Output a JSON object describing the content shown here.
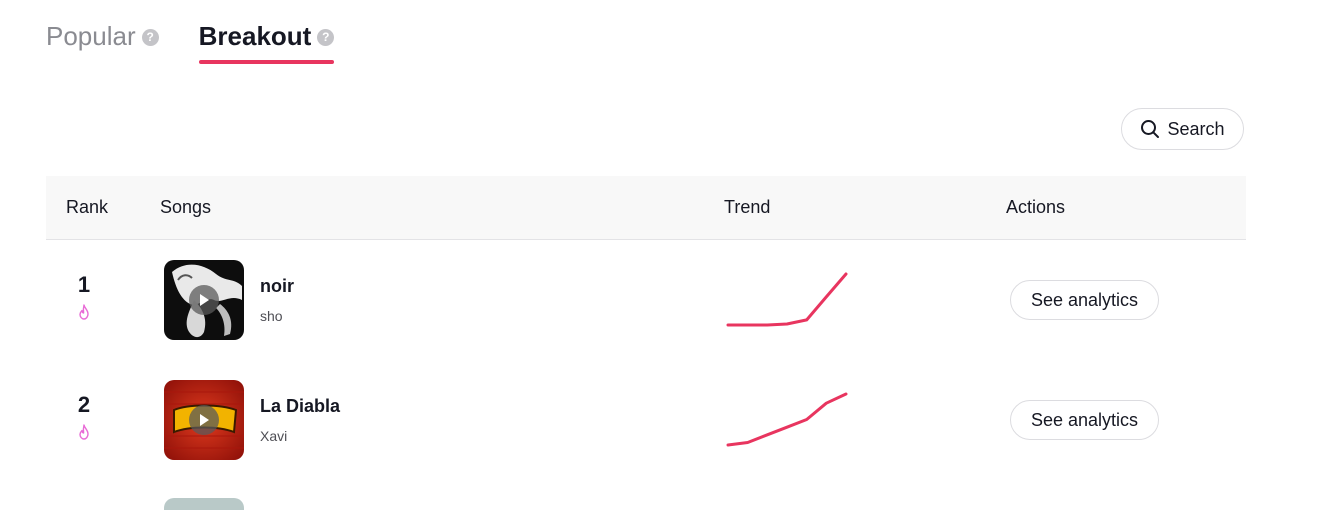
{
  "tabs": [
    {
      "label": "Popular",
      "active": false,
      "help_icon": "question-icon"
    },
    {
      "label": "Breakout",
      "active": true,
      "help_icon": "question-icon"
    }
  ],
  "colors": {
    "accent": "#e8355f",
    "fire": "#e86bd6"
  },
  "search": {
    "label": "Search",
    "icon": "search-icon"
  },
  "table": {
    "headers": {
      "rank": "Rank",
      "songs": "Songs",
      "trend": "Trend",
      "actions": "Actions"
    },
    "rows": [
      {
        "rank": "1",
        "rank_icon": "fire-icon",
        "title": "noir",
        "artist": "sho",
        "trend": [
          0.0,
          0.0,
          0.0,
          0.02,
          0.1,
          0.55,
          1.0
        ],
        "action": "See analytics"
      },
      {
        "rank": "2",
        "rank_icon": "fire-icon",
        "title": "La Diabla",
        "artist": "Xavi",
        "trend": [
          0.0,
          0.05,
          0.2,
          0.35,
          0.5,
          0.82,
          1.0
        ],
        "action": "See analytics"
      }
    ]
  }
}
